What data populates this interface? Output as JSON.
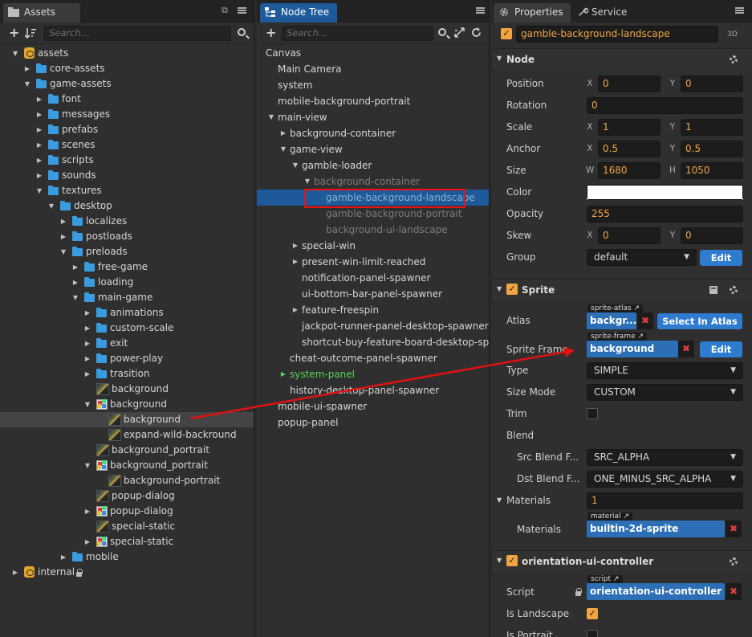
{
  "assets_panel": {
    "title": "Assets",
    "search_placeholder": "Search...",
    "tree": [
      {
        "label": "assets",
        "depth": 0,
        "icon": "db",
        "arrow": "down"
      },
      {
        "label": "core-assets",
        "depth": 1,
        "icon": "folder",
        "arrow": "right"
      },
      {
        "label": "game-assets",
        "depth": 1,
        "icon": "folder",
        "arrow": "down"
      },
      {
        "label": "font",
        "depth": 2,
        "icon": "folder",
        "arrow": "right"
      },
      {
        "label": "messages",
        "depth": 2,
        "icon": "folder",
        "arrow": "right"
      },
      {
        "label": "prefabs",
        "depth": 2,
        "icon": "folder",
        "arrow": "right"
      },
      {
        "label": "scenes",
        "depth": 2,
        "icon": "folder",
        "arrow": "right"
      },
      {
        "label": "scripts",
        "depth": 2,
        "icon": "folder",
        "arrow": "right"
      },
      {
        "label": "sounds",
        "depth": 2,
        "icon": "folder",
        "arrow": "right"
      },
      {
        "label": "textures",
        "depth": 2,
        "icon": "folder",
        "arrow": "down"
      },
      {
        "label": "desktop",
        "depth": 3,
        "icon": "folder",
        "arrow": "down"
      },
      {
        "label": "localizes",
        "depth": 4,
        "icon": "folder",
        "arrow": "right"
      },
      {
        "label": "postloads",
        "depth": 4,
        "icon": "folder",
        "arrow": "right"
      },
      {
        "label": "preloads",
        "depth": 4,
        "icon": "folder",
        "arrow": "down"
      },
      {
        "label": "free-game",
        "depth": 5,
        "icon": "folder",
        "arrow": "right"
      },
      {
        "label": "loading",
        "depth": 5,
        "icon": "folder",
        "arrow": "right"
      },
      {
        "label": "main-game",
        "depth": 5,
        "icon": "folder",
        "arrow": "down"
      },
      {
        "label": "animations",
        "depth": 6,
        "icon": "folder",
        "arrow": "right"
      },
      {
        "label": "custom-scale",
        "depth": 6,
        "icon": "folder",
        "arrow": "right"
      },
      {
        "label": "exit",
        "depth": 6,
        "icon": "folder",
        "arrow": "right"
      },
      {
        "label": "power-play",
        "depth": 6,
        "icon": "folder",
        "arrow": "right"
      },
      {
        "label": "trasition",
        "depth": 6,
        "icon": "folder",
        "arrow": "right"
      },
      {
        "label": "background",
        "depth": 6,
        "icon": "image",
        "arrow": ""
      },
      {
        "label": "background",
        "depth": 6,
        "icon": "atlas",
        "arrow": "down"
      },
      {
        "label": "background",
        "depth": 7,
        "icon": "image",
        "arrow": "",
        "selected": true
      },
      {
        "label": "expand-wild-backround",
        "depth": 7,
        "icon": "image",
        "arrow": ""
      },
      {
        "label": "background_portrait",
        "depth": 6,
        "icon": "image",
        "arrow": ""
      },
      {
        "label": "background_portrait",
        "depth": 6,
        "icon": "atlas",
        "arrow": "down"
      },
      {
        "label": "background-portrait",
        "depth": 7,
        "icon": "image",
        "arrow": ""
      },
      {
        "label": "popup-dialog",
        "depth": 6,
        "icon": "image",
        "arrow": ""
      },
      {
        "label": "popup-dialog",
        "depth": 6,
        "icon": "atlas",
        "arrow": "right"
      },
      {
        "label": "special-static",
        "depth": 6,
        "icon": "image",
        "arrow": ""
      },
      {
        "label": "special-static",
        "depth": 6,
        "icon": "atlas",
        "arrow": "right"
      },
      {
        "label": "mobile",
        "depth": 4,
        "icon": "folder",
        "arrow": "right"
      },
      {
        "label": "internal",
        "depth": 0,
        "icon": "db",
        "arrow": "right",
        "locked": true
      }
    ]
  },
  "node_tree_panel": {
    "title": "Node Tree",
    "search_placeholder": "Search...",
    "nodes": [
      {
        "label": "Canvas",
        "depth": 0,
        "arrow": ""
      },
      {
        "label": "Main Camera",
        "depth": 1,
        "arrow": ""
      },
      {
        "label": "system",
        "depth": 1,
        "arrow": ""
      },
      {
        "label": "mobile-background-portrait",
        "depth": 1,
        "arrow": ""
      },
      {
        "label": "main-view",
        "depth": 1,
        "arrow": "down"
      },
      {
        "label": "background-container",
        "depth": 2,
        "arrow": "right"
      },
      {
        "label": "game-view",
        "depth": 2,
        "arrow": "down"
      },
      {
        "label": "gamble-loader",
        "depth": 3,
        "arrow": "down"
      },
      {
        "label": "background-container",
        "depth": 4,
        "arrow": "down",
        "dim": true
      },
      {
        "label": "gamble-background-landscape",
        "depth": 5,
        "arrow": "",
        "dim": true,
        "selected": true
      },
      {
        "label": "gamble-background-portrait",
        "depth": 5,
        "arrow": "",
        "dim": true
      },
      {
        "label": "background-ui-landscape",
        "depth": 5,
        "arrow": "",
        "dim": true
      },
      {
        "label": "special-win",
        "depth": 3,
        "arrow": "right"
      },
      {
        "label": "present-win-limit-reached",
        "depth": 3,
        "arrow": "right"
      },
      {
        "label": "notification-panel-spawner",
        "depth": 3,
        "arrow": ""
      },
      {
        "label": "ui-bottom-bar-panel-spawner",
        "depth": 3,
        "arrow": ""
      },
      {
        "label": "feature-freespin",
        "depth": 3,
        "arrow": "right"
      },
      {
        "label": "jackpot-runner-panel-desktop-spawner",
        "depth": 3,
        "arrow": ""
      },
      {
        "label": "shortcut-buy-feature-board-desktop-spawner",
        "depth": 3,
        "arrow": ""
      },
      {
        "label": "cheat-outcome-panel-spawner",
        "depth": 2,
        "arrow": ""
      },
      {
        "label": "system-panel",
        "depth": 2,
        "arrow": "right",
        "green": true
      },
      {
        "label": "history-desktop-panel-spawner",
        "depth": 2,
        "arrow": ""
      },
      {
        "label": "mobile-ui-spawner",
        "depth": 1,
        "arrow": ""
      },
      {
        "label": "popup-panel",
        "depth": 1,
        "arrow": ""
      }
    ]
  },
  "properties_panel": {
    "tab_properties": "Properties",
    "tab_service": "Service",
    "node_name": "gamble-background-landscape",
    "mode_3d": "3D",
    "node_section": {
      "title": "Node",
      "position": {
        "label": "Position",
        "x": "0",
        "y": "0"
      },
      "rotation": {
        "label": "Rotation",
        "value": "0"
      },
      "scale": {
        "label": "Scale",
        "x": "1",
        "y": "1"
      },
      "anchor": {
        "label": "Anchor",
        "x": "0.5",
        "y": "0.5"
      },
      "size": {
        "label": "Size",
        "w": "1680",
        "h": "1050"
      },
      "color": {
        "label": "Color",
        "value": "#ffffff"
      },
      "opacity": {
        "label": "Opacity",
        "value": "255"
      },
      "skew": {
        "label": "Skew",
        "x": "0",
        "y": "0"
      },
      "group": {
        "label": "Group",
        "value": "default",
        "edit": "Edit"
      },
      "axis_x": "X",
      "axis_y": "Y",
      "axis_w": "W",
      "axis_h": "H"
    },
    "sprite_section": {
      "title": "Sprite",
      "atlas": {
        "label": "Atlas",
        "tag": "sprite-atlas",
        "value": "backgr...",
        "button": "Select In Atlas"
      },
      "sprite_frame": {
        "label": "Sprite Frame",
        "tag": "sprite-frame",
        "value": "background",
        "button": "Edit"
      },
      "type": {
        "label": "Type",
        "value": "SIMPLE"
      },
      "size_mode": {
        "label": "Size Mode",
        "value": "CUSTOM"
      },
      "trim": {
        "label": "Trim",
        "checked": false
      },
      "blend": {
        "label": "Blend"
      },
      "src_blend": {
        "label": "Src Blend F...",
        "value": "SRC_ALPHA"
      },
      "dst_blend": {
        "label": "Dst Blend F...",
        "value": "ONE_MINUS_SRC_ALPHA"
      },
      "materials_count": {
        "label": "Materials",
        "value": "1"
      },
      "materials_item": {
        "label": "Materials",
        "tag": "material",
        "value": "builtin-2d-sprite"
      }
    },
    "controller_section": {
      "title": "orientation-ui-controller",
      "script": {
        "label": "Script",
        "tag": "script",
        "value": "orientation-ui-controller"
      },
      "is_landscape": {
        "label": "Is Landscape",
        "checked": true
      },
      "is_portrait": {
        "label": "Is Portrait",
        "checked": false
      }
    }
  },
  "colors": {
    "accent": "#f0a542",
    "selection": "#1e5a9a",
    "button": "#2f7bd0",
    "annotation": "#e11111"
  }
}
